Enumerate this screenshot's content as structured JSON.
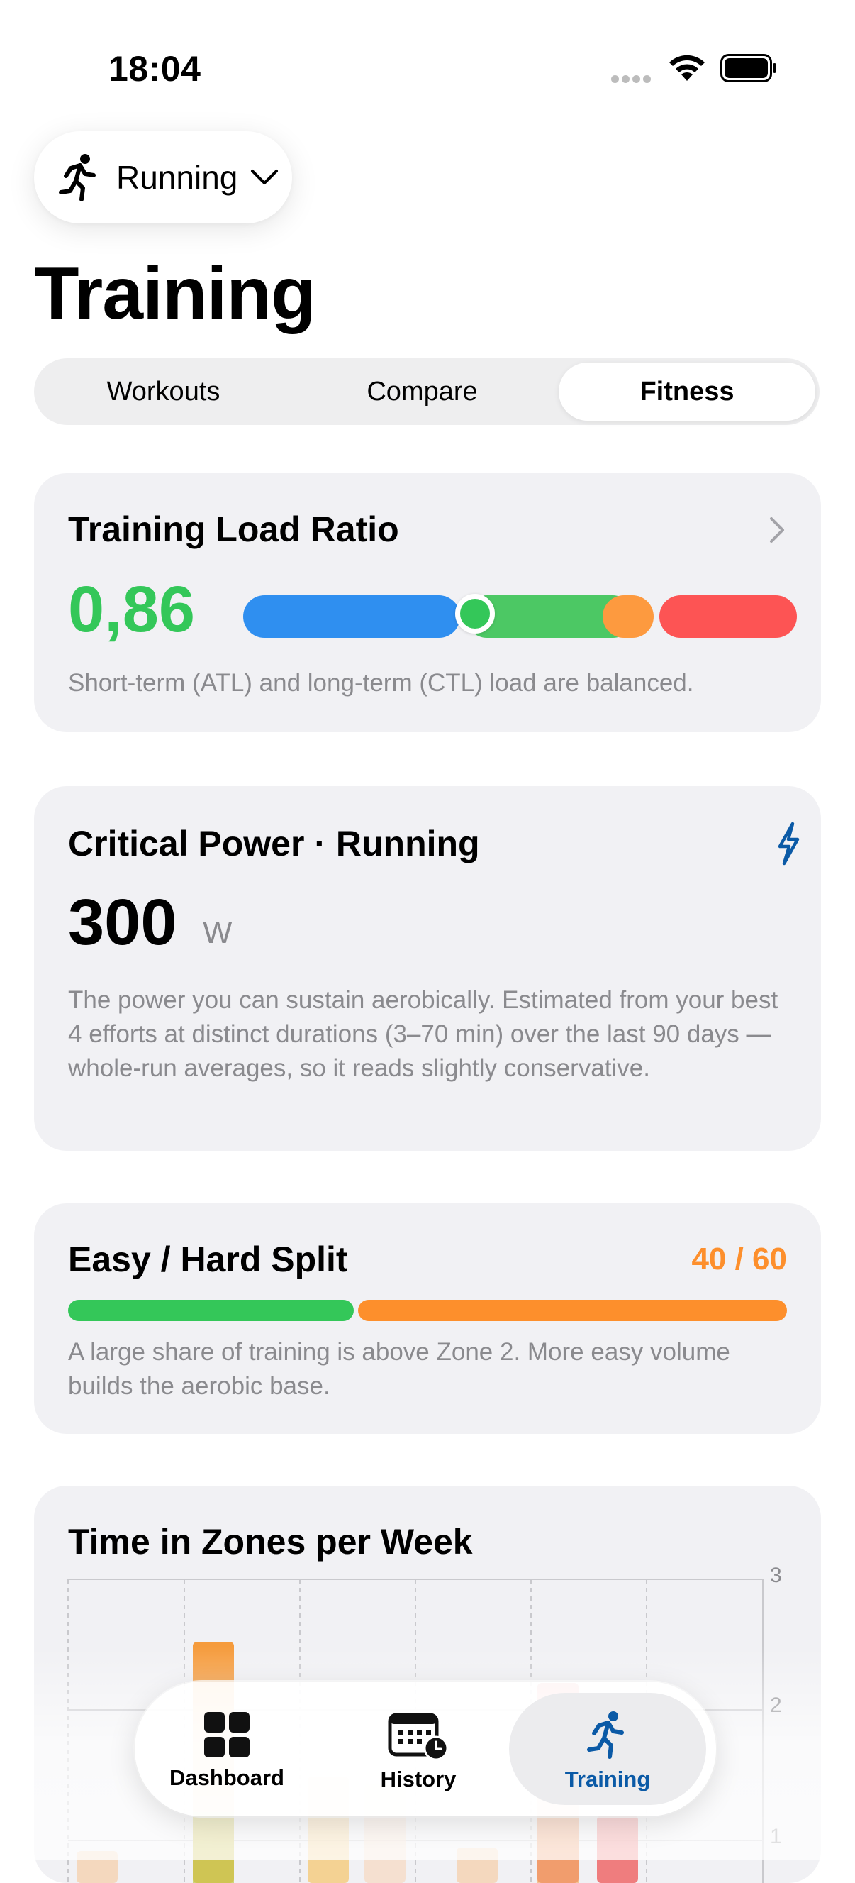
{
  "status": {
    "time": "18:04"
  },
  "sport_selector": {
    "label": "Running",
    "icon": "runner-icon"
  },
  "page_title": "Training",
  "tabs": [
    {
      "label": "Workouts",
      "active": false
    },
    {
      "label": "Compare",
      "active": false
    },
    {
      "label": "Fitness",
      "active": true
    }
  ],
  "training_load": {
    "title": "Training Load Ratio",
    "value": "0,86",
    "description": "Short-term (ATL) and long-term (CTL) load are balanced.",
    "value_color": "#34c759",
    "zones": [
      {
        "name": "low",
        "color": "#2f8ff0"
      },
      {
        "name": "optimal",
        "color": "#4cc864"
      },
      {
        "name": "high",
        "color": "#fd9a3f"
      },
      {
        "name": "very-high",
        "color": "#fd5454"
      }
    ]
  },
  "critical_power": {
    "title": "Critical Power · Running",
    "value": "300",
    "unit": "W",
    "icon": "bolt-icon",
    "description": "The power you can sustain aerobically. Estimated from your best 4 efforts at distinct durations (3–70 min) over the last 90 days — whole-run averages, so it reads slightly conservative."
  },
  "easy_hard": {
    "title": "Easy / Hard Split",
    "ratio": "40 / 60",
    "easy_fraction": 0.4,
    "description": "A large share of training is above Zone 2. More easy volume builds the aerobic base.",
    "easy_color": "#34c759",
    "hard_color": "#fd8f2c"
  },
  "zones_chart": {
    "title": "Time in Zones per Week"
  },
  "chart_data": {
    "type": "bar",
    "title": "Time in Zones per Week",
    "ylim": [
      0,
      3
    ],
    "yticks": [
      "3",
      "2",
      "1"
    ],
    "grid": true
  },
  "tabbar": {
    "items": [
      {
        "label": "Dashboard",
        "icon": "dashboard-icon",
        "active": false
      },
      {
        "label": "History",
        "icon": "calendar-clock-icon",
        "active": false
      },
      {
        "label": "Training",
        "icon": "runner-icon",
        "active": true
      }
    ],
    "active_color": "#0b5aa6"
  }
}
